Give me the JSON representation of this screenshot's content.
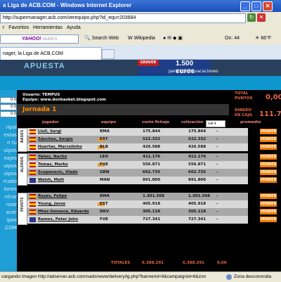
{
  "window": {
    "title": "a Liga de ACB.COM - Windows Internet Explorer",
    "minimize": "_",
    "maximize": "□",
    "close": "✕"
  },
  "address": {
    "url": "http://supermanager.acb.com/verequipo.php?id_equ=203684",
    "go": "↻",
    "stop": "✕"
  },
  "menu": [
    "r",
    "Favoritos",
    "Herramientas",
    "Ayuda"
  ],
  "yahoo": {
    "logo": "YAHOO!",
    "sub": "SEARCH",
    "search_web": "Search Web",
    "wikipedia": "Wikipedia",
    "weather": "66°F",
    "count": "On: 44"
  },
  "tab": {
    "label": "nager, la Liga de ACB.COM"
  },
  "page": {
    "banner_text": "APUESTA",
    "ad_brand": "GRAVER",
    "ad_amount": "1.500 euros",
    "ad_sub": "para irte de vacaciones",
    "side_boxes": [
      "0.0",
      "0.0",
      "0.0"
    ],
    "side_links": [
      "ripal",
      "estas",
      "n tu",
      "uipos",
      "najes",
      "uipos",
      "uipos",
      "rcado",
      "lones",
      "ntrar",
      "nzar",
      "acer",
      "ipos",
      ".COM"
    ],
    "user": "Usuario: TEMPUS",
    "team": "Equipo: www.donbasket.blogspot.com",
    "jornada": "Jornada 1",
    "total_label_1": "TOTAL",
    "total_label_2": "PUNTOS",
    "total_value": "0,00",
    "caja_label_1": "DINERO",
    "caja_label_2": "EN CAJA",
    "caja_value": "111.70",
    "headers": {
      "jugador": "jugador",
      "equipo": "equipo",
      "coste": "coste fichaje",
      "cotizacion": "cotización",
      "promedio": "promedio"
    },
    "sort_value": "val",
    "sections": {
      "bases": "BASES",
      "aleros": "ALEROS",
      "pivots": "PIVOTS"
    },
    "players": [
      {
        "name": "Llull, Sergi",
        "team": "RMA",
        "cost": "175.844",
        "cot": "175.844",
        "dash": "-",
        "sell": "VENDER"
      },
      {
        "name": "Sánchez, Sergio",
        "team": "EST",
        "cost": "522.332",
        "cot": "522.332",
        "dash": "-",
        "sell": "VENDER"
      },
      {
        "name": "Huertas, Marcelinho",
        "team": "BLB",
        "cost": "426.588",
        "cot": "426.588",
        "dash": "-",
        "sell": "VENDER"
      },
      {
        "name": "Yáñez, Nacho",
        "team": "LEO",
        "cost": "412.176",
        "cot": "412.176",
        "dash": "-",
        "sell": "VENDER"
      },
      {
        "name": "Tomas, Marko",
        "team": "FUE",
        "cost": "556.871",
        "cot": "556.871",
        "dash": "-",
        "sell": "VENDER"
      },
      {
        "name": "Scepanovic, Vlado",
        "team": "GRN",
        "cost": "662.735",
        "cot": "662.735",
        "dash": "-",
        "sell": "VENDER"
      },
      {
        "name": "Walsh, Matt",
        "team": "MAN",
        "cost": "891.800",
        "cot": "891.800",
        "dash": "-",
        "sell": "VENDER"
      },
      {
        "name": "Reyes, Felipe",
        "team": "RMA",
        "cost": "1.301.568",
        "cot": "1.301.568",
        "dash": "-",
        "sell": "VENDER"
      },
      {
        "name": "Young, Jesse",
        "team": "EST",
        "cost": "405.918",
        "cot": "405.918",
        "dash": "-",
        "sell": "VENDER"
      },
      {
        "name": "Mtez-Sonseca, Eduardo",
        "team": "DKV",
        "cost": "305.118",
        "cot": "305.118",
        "dash": "-",
        "sell": "VENDER"
      },
      {
        "name": "Ramos, Peter John",
        "team": "FUE",
        "cost": "727.341",
        "cot": "727.341",
        "dash": "-",
        "sell": "VENDER"
      }
    ],
    "totals": {
      "label": "TOTALES",
      "cost": "6.388.291",
      "cot": "6.388.291",
      "promedio": "0,00"
    }
  },
  "status": {
    "text": "cargando imagen http://adserver.acb.com/oads/www/delivery/lg.php?bannerid=9&campaignid=8&zon",
    "zone": "Zona desconocida"
  },
  "colors": {
    "row_light": "#d8d8d8",
    "row_dark": "#a8a8a8",
    "accent_orange": "#f07c00"
  }
}
